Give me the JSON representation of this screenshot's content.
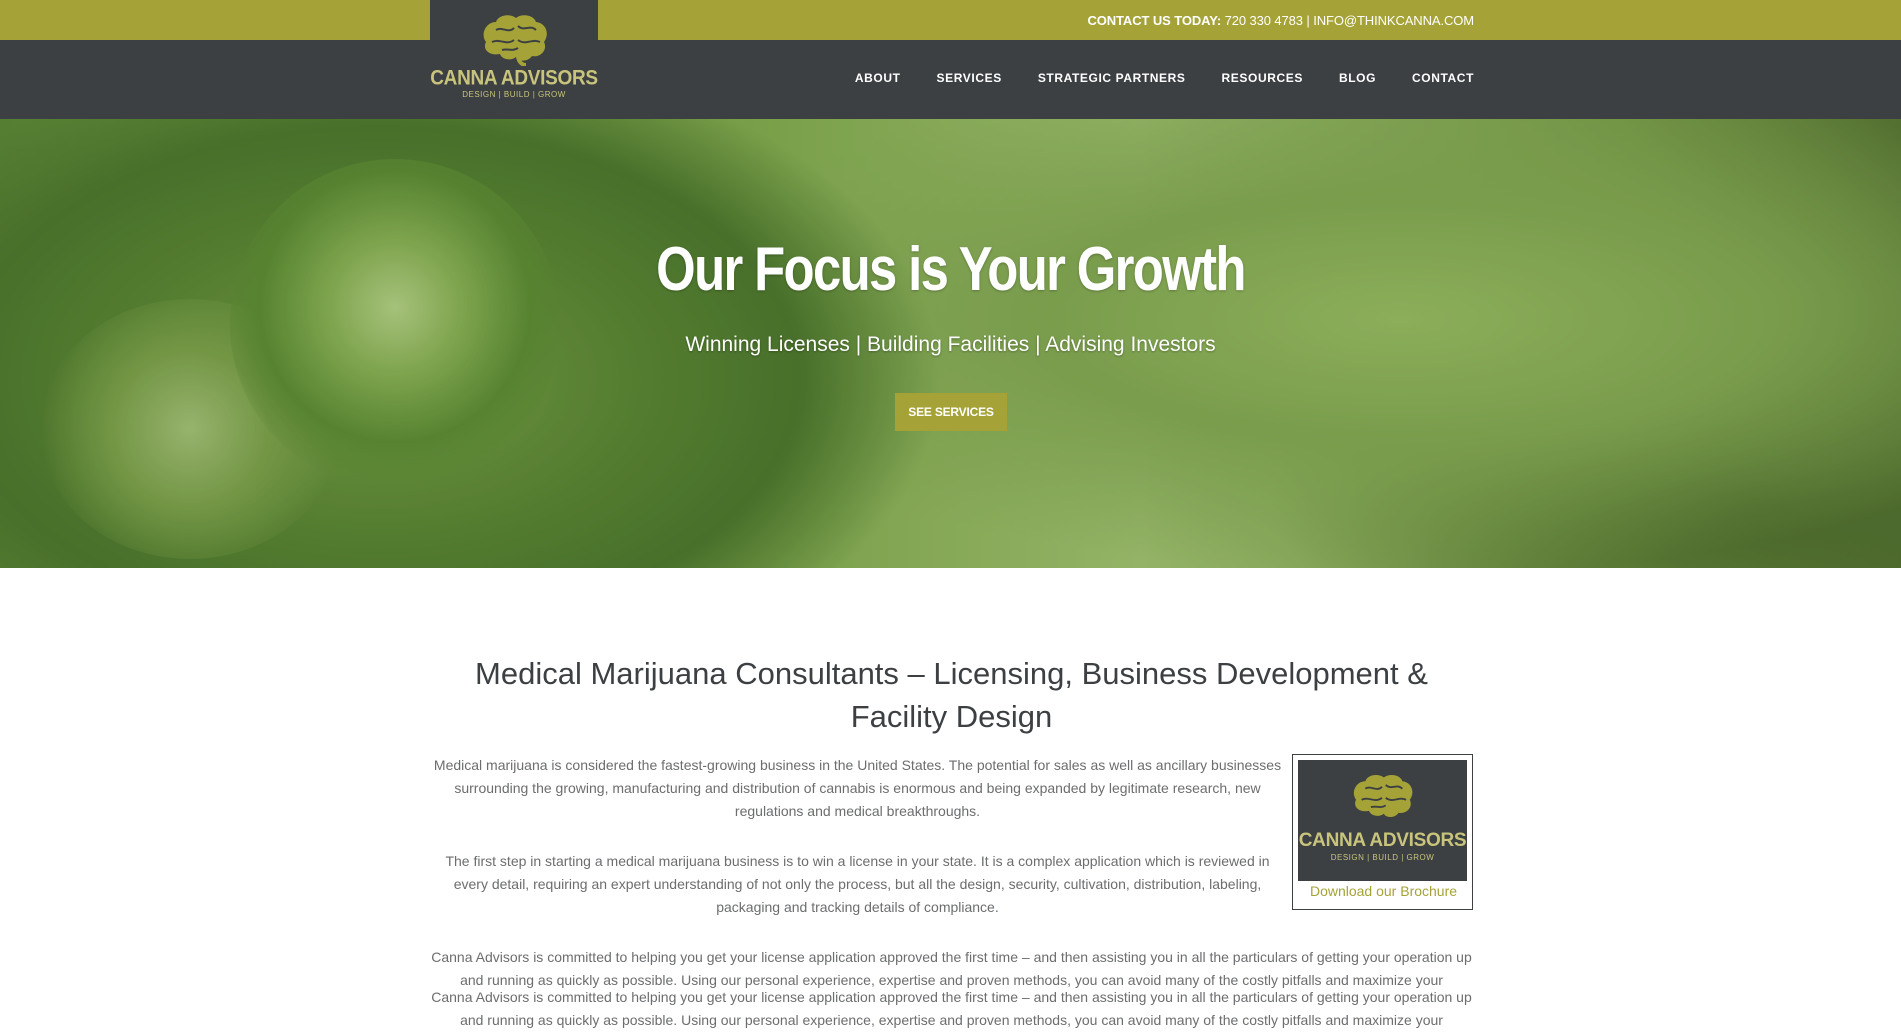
{
  "topbar": {
    "contact_label": "CONTACT US TODAY:",
    "contact_rest": " 720 330 4783 | INFO@THINKCANNA.COM"
  },
  "logo": {
    "name": "CANNA ADVISORS",
    "tagline": "DESIGN | BUILD | GROW"
  },
  "nav": {
    "items": [
      "ABOUT",
      "SERVICES",
      "STRATEGIC PARTNERS",
      "RESOURCES",
      "BLOG",
      "CONTACT"
    ]
  },
  "hero": {
    "title": "Our Focus is Your Growth",
    "subtitle": "Winning Licenses | Building Facilities | Advising Investors",
    "button": "SEE SERVICES"
  },
  "content": {
    "heading": "Medical Marijuana Consultants – Licensing, Business Development & Facility Design",
    "paragraphs": [
      "Medical marijuana is considered the fastest-growing business in the United States. The potential for sales as well as ancillary businesses surrounding the growing, manufacturing and distribution of cannabis is enormous and being expanded by legitimate research, new regulations and medical breakthroughs.",
      "The first step in starting a medical marijuana business is to win a license in your state. It is a complex application which is reviewed in every detail, requiring an expert understanding of not only the process, but all the design, security, cultivation, distribution, labeling, packaging and tracking details of compliance.",
      "Canna Advisors is committed to helping you get your license application approved the first time – and then assisting you in all the particulars of getting your operation up and running as quickly as possible. Using our personal experience, expertise and proven methods, you can avoid many of the costly pitfalls and maximize your",
      "Canna Advisors is committed to helping you get your license application approved the first time – and then assisting you in all the particulars of getting your operation up and running as quickly as possible. Using our personal experience, expertise and proven methods, you can avoid many of the costly pitfalls and maximize your"
    ],
    "brochure": {
      "name": "CANNA ADVISORS",
      "tagline": "DESIGN | BUILD | GROW",
      "link": "Download our Brochure"
    }
  },
  "colors": {
    "olive": "#a5a337",
    "dark": "#3c4043",
    "logo_text": "#c9c47c"
  }
}
